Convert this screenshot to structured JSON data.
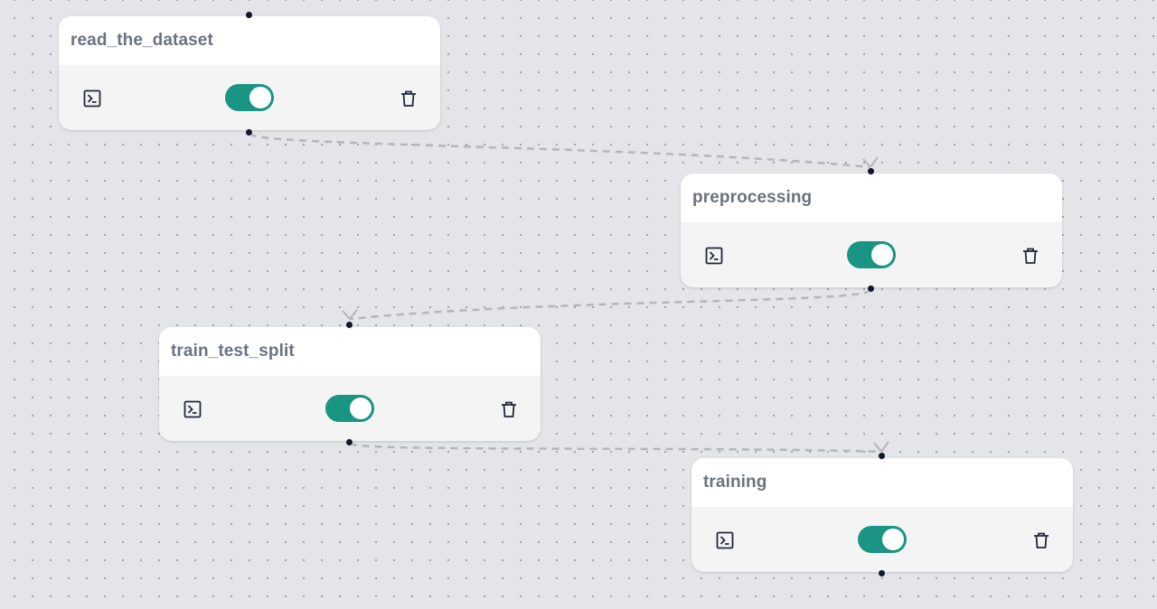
{
  "nodes": [
    {
      "id": "read_the_dataset",
      "title": "read_the_dataset",
      "enabled": true
    },
    {
      "id": "preprocessing",
      "title": "preprocessing",
      "enabled": true
    },
    {
      "id": "train_test_split",
      "title": "train_test_split",
      "enabled": true
    },
    {
      "id": "training",
      "title": "training",
      "enabled": true
    }
  ],
  "edges": [
    {
      "from": "read_the_dataset",
      "to": "preprocessing"
    },
    {
      "from": "preprocessing",
      "to": "train_test_split"
    },
    {
      "from": "train_test_split",
      "to": "training"
    }
  ],
  "icons": {
    "terminal": "terminal-icon",
    "delete": "trash-icon"
  },
  "colors": {
    "canvas_background": "#e4e5e9",
    "toggle_on": "#1a9483",
    "edge": "#b4b6bb",
    "title_text": "#6b7280"
  }
}
